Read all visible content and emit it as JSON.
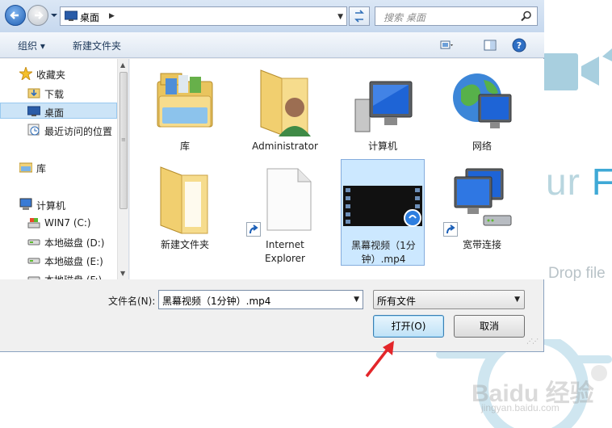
{
  "background_page": {
    "title_partial": "ur",
    "title_partial_highlight": "Fi",
    "drop_text": "Drop file",
    "watermark": "Baidu 经验",
    "watermark_url": "jingyan.baidu.com",
    "accent_color": "#3fa9d6"
  },
  "address_bar": {
    "location": "桌面",
    "search_placeholder": "搜索 桌面"
  },
  "toolbar": {
    "organize_label": "组织",
    "new_folder_label": "新建文件夹"
  },
  "nav_pane": {
    "items": [
      {
        "label": "收藏夹",
        "icon": "star-icon"
      },
      {
        "label": "下载",
        "icon": "download-folder-icon"
      },
      {
        "label": "桌面",
        "icon": "desktop-icon",
        "selected": true
      },
      {
        "label": "最近访问的位置",
        "icon": "recent-places-icon"
      },
      {
        "label": "库",
        "icon": "library-icon"
      },
      {
        "label": "计算机",
        "icon": "computer-icon"
      },
      {
        "label": "WIN7 (C:)",
        "icon": "system-drive-icon"
      },
      {
        "label": "本地磁盘 (D:)",
        "icon": "drive-icon"
      },
      {
        "label": "本地磁盘 (E:)",
        "icon": "drive-icon"
      },
      {
        "label": "本地磁盘 (F:)",
        "icon": "drive-icon"
      }
    ]
  },
  "files": [
    {
      "label": "库",
      "icon": "library-folder-icon"
    },
    {
      "label": "Administrator",
      "icon": "user-folder-icon"
    },
    {
      "label": "计算机",
      "icon": "computer-icon"
    },
    {
      "label": "网络",
      "icon": "network-globe-icon"
    },
    {
      "label": "新建文件夹",
      "icon": "folder-icon"
    },
    {
      "label": "Internet Explorer",
      "icon": "shortcut-file-icon"
    },
    {
      "label": "黑幕视频（1分钟）.mp4",
      "icon": "video-file-icon",
      "selected": true
    },
    {
      "label": "宽带连接",
      "icon": "broadband-connection-icon"
    }
  ],
  "bottom": {
    "filename_label": "文件名(N):",
    "filename_value": "黑幕视频（1分钟）.mp4",
    "filetype_value": "所有文件",
    "open_button": "打开(O)",
    "cancel_button": "取消"
  }
}
